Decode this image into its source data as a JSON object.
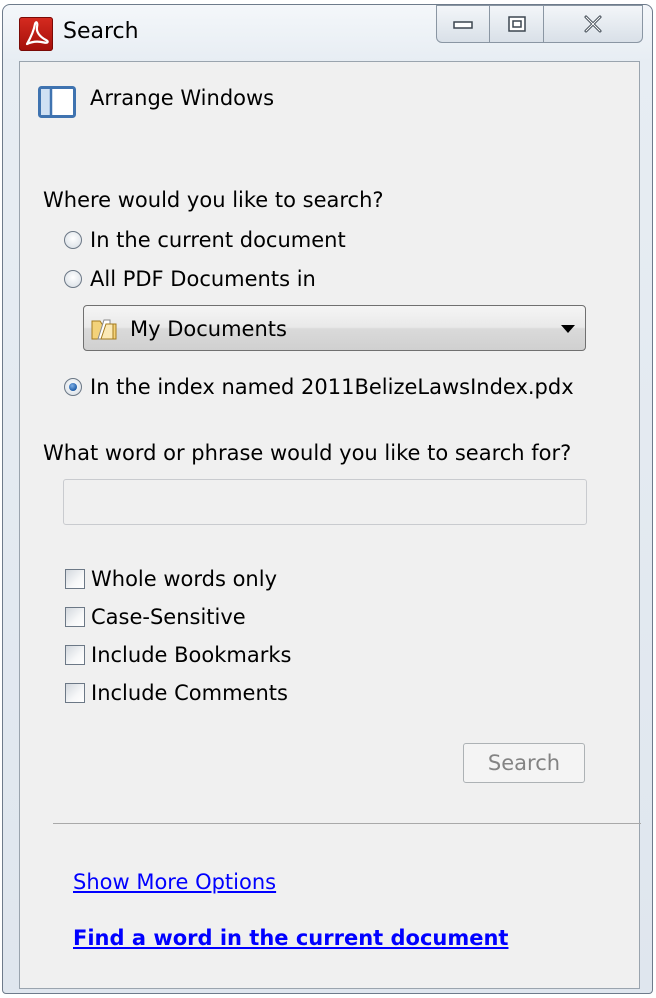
{
  "window": {
    "title": "Search",
    "controls": {
      "minimize_icon": "minimize-icon",
      "maximize_icon": "restore-icon",
      "close_icon": "close-icon"
    }
  },
  "arrange": {
    "icon": "arrange-windows-icon",
    "label": "Arrange Windows"
  },
  "where": {
    "question": "Where would you like to search?",
    "options": [
      {
        "label": "In the current document",
        "checked": false
      },
      {
        "label": "All PDF Documents in",
        "checked": false
      },
      {
        "label": "In the index named 2011BelizeLawsIndex.pdx",
        "checked": true
      }
    ],
    "location_select": {
      "icon": "folder-icon",
      "value": "My Documents"
    }
  },
  "phrase": {
    "question": "What word or phrase would you like to search for?",
    "value": ""
  },
  "options": [
    {
      "label": "Whole words only",
      "checked": false
    },
    {
      "label": "Case-Sensitive",
      "checked": false
    },
    {
      "label": "Include Bookmarks",
      "checked": false
    },
    {
      "label": "Include Comments",
      "checked": false
    }
  ],
  "search_button": {
    "label": "Search",
    "enabled": false
  },
  "links": {
    "more_options": "Show More Options",
    "find_word": "Find a word in the current document"
  },
  "colors": {
    "link": "#0000ff",
    "acrobat_red": "#c41e13",
    "disabled_text": "#838383",
    "panel_bg": "#f0f0f0"
  }
}
